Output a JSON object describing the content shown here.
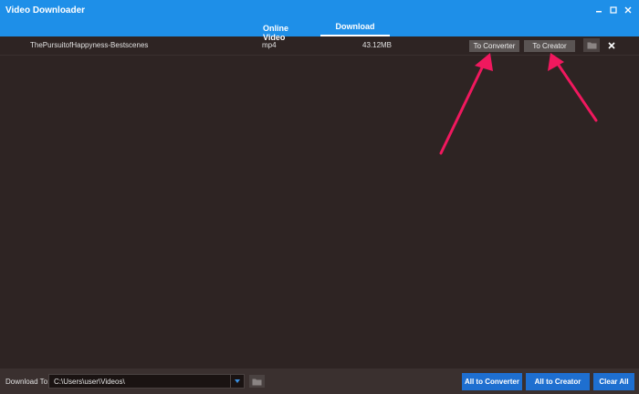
{
  "window": {
    "title": "Video Downloader"
  },
  "tabs": [
    {
      "label": "Online Video",
      "active": false
    },
    {
      "label": "Download",
      "active": true
    }
  ],
  "downloads": [
    {
      "name": "ThePursuitofHappyness-Bestscenes",
      "format": "mp4",
      "size": "43.12MB",
      "to_converter_label": "To Converter",
      "to_creator_label": "To Creator"
    }
  ],
  "footer": {
    "download_to_label": "Download To:",
    "path_value": "C:\\Users\\user\\Videos\\",
    "all_to_converter_label": "All to Converter",
    "all_to_creator_label": "All to Creator",
    "clear_all_label": "Clear All"
  },
  "icons": {
    "minimize": "minimize-icon",
    "maximize": "maximize-icon",
    "close": "close-icon",
    "folder": "folder-icon",
    "dropdown": "chevron-down-icon"
  },
  "colors": {
    "titlebar": "#1e8fe8",
    "background": "#2e2423",
    "accent_button": "#1e6fd0",
    "annotation_arrow": "#f0185e"
  }
}
